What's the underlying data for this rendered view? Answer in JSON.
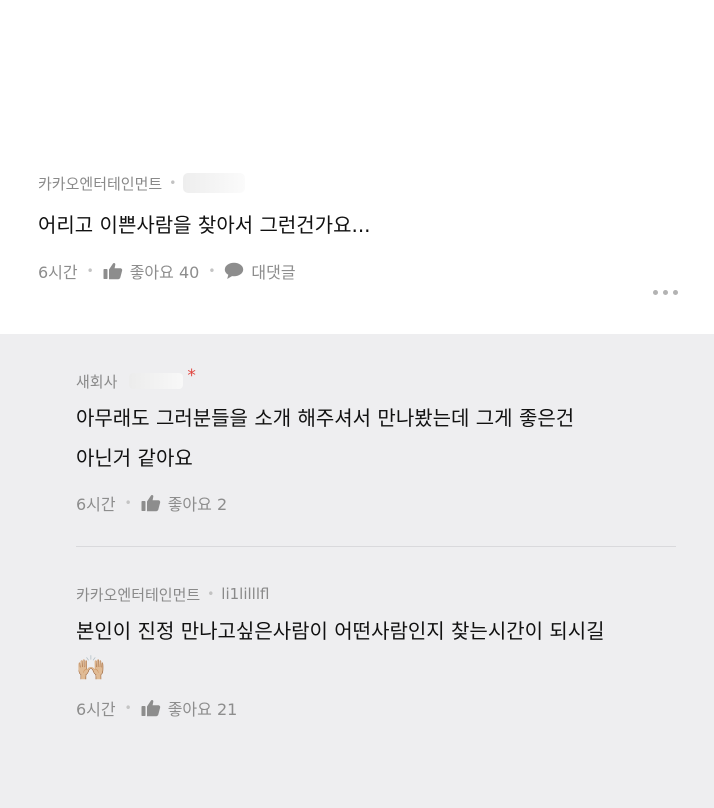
{
  "main_comment": {
    "author": "카카오엔터테인먼트",
    "text": "어리고 이쁜사람을 찾아서 그런건가요...",
    "time": "6시간",
    "like_label": "좋아요 40",
    "reply_label": "대댓글"
  },
  "replies": [
    {
      "author": "새회사",
      "text_line1": "아무래도 그러분들을 소개 해주셔서 만나봤는데 그게 좋은건",
      "text_line2": "아닌거 같아요",
      "time": "6시간",
      "like_label": "좋아요 2"
    },
    {
      "author": "카카오엔터테인먼트",
      "handle": "li1lilllfl",
      "text": "본인이 진정 만나고싶은사람이 어떤사람인지 찾는시간이 되시길",
      "emoji": "🙌🏼",
      "time": "6시간",
      "like_label": "좋아요 21"
    }
  ],
  "colors": {
    "reply_background": "#eeeef0",
    "meta_text": "#8a8a8a",
    "asterisk": "#e0443e"
  },
  "icons": [
    "thumbs-up-icon",
    "speech-bubble-icon",
    "more-options-icon"
  ]
}
